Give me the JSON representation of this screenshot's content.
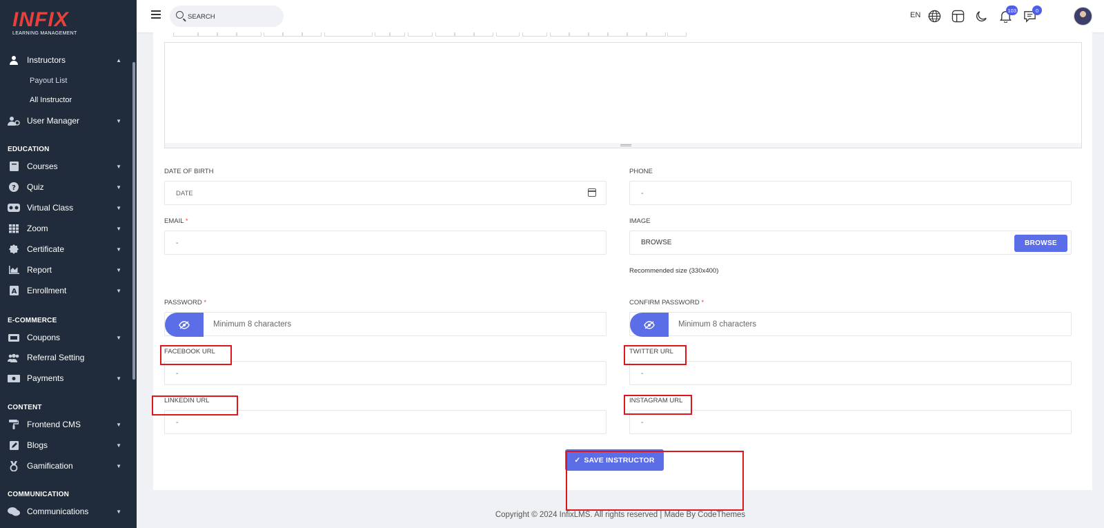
{
  "logo": {
    "main": "INFIX",
    "sub": "LEARNING MANAGEMENT"
  },
  "sidebar": {
    "instructors": {
      "label": "Instructors",
      "sub": [
        "Payout List",
        "All Instructor"
      ]
    },
    "user_manager": "User Manager",
    "sections": {
      "education": "EDUCATION",
      "ecommerce": "E-COMMERCE",
      "content": "CONTENT",
      "communication": "COMMUNICATION"
    },
    "education_items": [
      "Courses",
      "Quiz",
      "Virtual Class",
      "Zoom",
      "Certificate",
      "Report",
      "Enrollment"
    ],
    "ecommerce_items": [
      "Coupons",
      "Referral Setting",
      "Payments"
    ],
    "content_items": [
      "Frontend CMS",
      "Blogs",
      "Gamification"
    ],
    "communication_items": [
      "Communications"
    ]
  },
  "header": {
    "search_placeholder": "SEARCH",
    "lang": "EN",
    "notification_count": "103",
    "message_count": "0"
  },
  "form": {
    "dob": {
      "label": "DATE OF BIRTH",
      "placeholder": "DATE"
    },
    "phone": {
      "label": "PHONE",
      "value": "-"
    },
    "email": {
      "label": "EMAIL",
      "required": "*",
      "value": "-"
    },
    "image": {
      "label": "IMAGE",
      "browse_text": "BROWSE",
      "browse_button": "BROWSE",
      "hint": "Recommended size (330x400)"
    },
    "password": {
      "label": "PASSWORD",
      "required": "*",
      "placeholder": "Minimum 8 characters"
    },
    "confirm_password": {
      "label": "CONFIRM PASSWORD",
      "required": "*",
      "placeholder": "Minimum 8 characters"
    },
    "facebook": {
      "label": "FACEBOOK URL",
      "value": "-"
    },
    "twitter": {
      "label": "TWITTER URL",
      "value": "-"
    },
    "linkedin": {
      "label": "LINKEDIN URL",
      "value": "-"
    },
    "instagram": {
      "label": "INSTAGRAM URL",
      "value": "-"
    },
    "save_button": "SAVE INSTRUCTOR"
  },
  "footer": {
    "text": "Copyright © 2024 InfixLMS. All rights reserved | Made By CodeThemes"
  },
  "colors": {
    "accent": "#5b6ee8",
    "sidebar_bg": "#202c3b",
    "brand_red": "#e8413c",
    "highlight": "#e0141b"
  }
}
